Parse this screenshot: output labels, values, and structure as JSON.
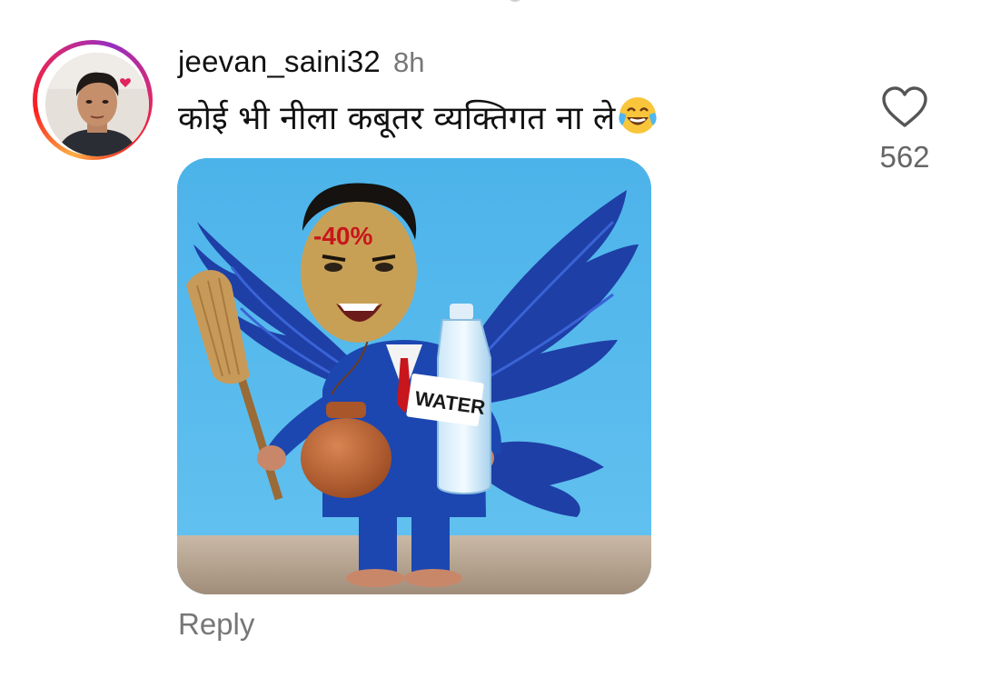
{
  "comment": {
    "username": "jeevan_saini32",
    "time_ago": "8h",
    "text": "कोई भी नीला कबूतर व्यक्तिगत ना ले",
    "emoji": "face-with-tears-of-joy",
    "likes": "562",
    "reply_label": "Reply"
  },
  "media": {
    "forehead_text": "-40%",
    "bottle_label": "WATER"
  },
  "colors": {
    "ring_gradient": [
      "#fcb045",
      "#fd1d1d",
      "#d62976",
      "#962fbf"
    ],
    "muted_text": "#777777",
    "image_background": "#5ab9ec",
    "suit_blue": "#1c47b0"
  }
}
